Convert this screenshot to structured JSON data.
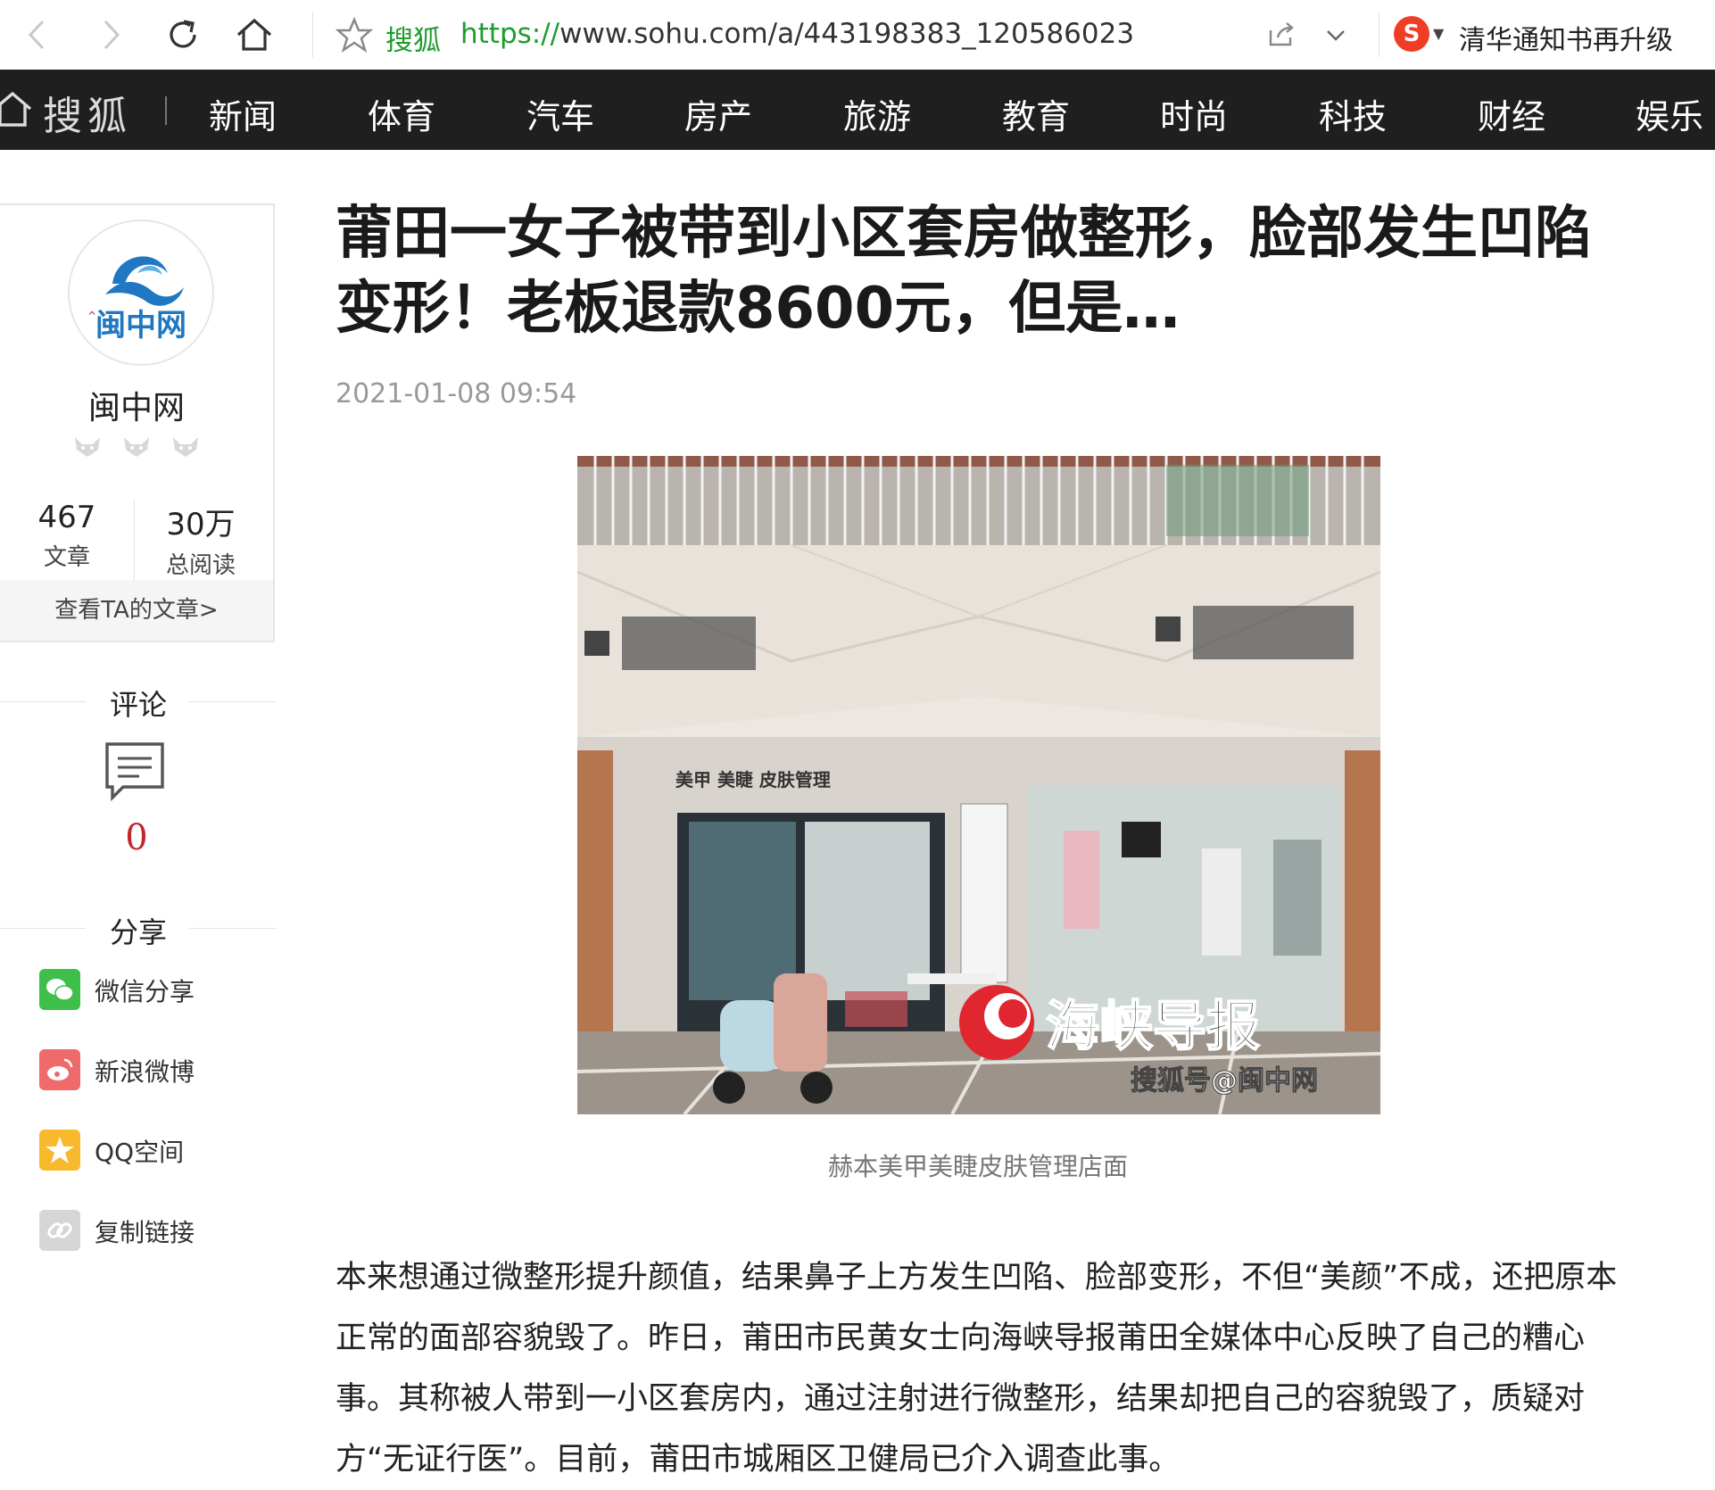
{
  "browser": {
    "site_name": "搜狐",
    "url_protocol": "https://",
    "url_rest": "www.sohu.com/a/443198383_120586023",
    "search_engine_letter": "S",
    "search_text": "清华通知书再升级",
    "icons": [
      "back-arrow-icon",
      "forward-arrow-icon",
      "reload-icon",
      "home-icon",
      "star-icon",
      "share-icon",
      "chevron-down-icon"
    ]
  },
  "nav": {
    "logo": "搜狐",
    "items": [
      "新闻",
      "体育",
      "汽车",
      "房产",
      "旅游",
      "教育",
      "时尚",
      "科技",
      "财经",
      "娱乐"
    ]
  },
  "author": {
    "logo_text": "闽中网",
    "name": "闽中网",
    "articles_count": "467",
    "articles_label": "文章",
    "reads_count": "30万",
    "reads_label": "总阅读",
    "link": "查看TA的文章>"
  },
  "comments": {
    "title": "评论",
    "count": "0"
  },
  "share": {
    "title": "分享",
    "items": [
      {
        "label": "微信分享",
        "icon": "wechat-icon",
        "color": "#3dbf4a"
      },
      {
        "label": "新浪微博",
        "icon": "weibo-icon",
        "color": "#ef6a6a"
      },
      {
        "label": "QQ空间",
        "icon": "qzone-star-icon",
        "color": "#f9b92d"
      },
      {
        "label": "复制链接",
        "icon": "link-icon",
        "color": "#d6d6d6"
      }
    ]
  },
  "article": {
    "title": "莆田一女子被带到小区套房做整形，脸部发生凹陷变形！老板退款8600元，但是…",
    "date": "2021-01-08 09:54",
    "photo_shop_sign": "美甲 美睫 皮肤管理",
    "photo_watermark_main": "海峡导报",
    "photo_watermark_sub": "搜狐号@闽中网",
    "caption": "赫本美甲美睫皮肤管理店面",
    "body": "本来想通过微整形提升颜值，结果鼻子上方发生凹陷、脸部变形，不但“美颜”不成，还把原本正常的面部容貌毁了。昨日，莆田市民黄女士向海峡导报莆田全媒体中心反映了自己的糟心事。其称被人带到一小区套房内，通过注射进行微整形，结果却把自己的容貌毁了，质疑对方“无证行医”。目前，莆田市城厢区卫健局已介入调查此事。"
  },
  "colors": {
    "nav_bg": "#1f1f1f",
    "accent_red": "#c1272d",
    "url_green": "#1e9c2e"
  }
}
